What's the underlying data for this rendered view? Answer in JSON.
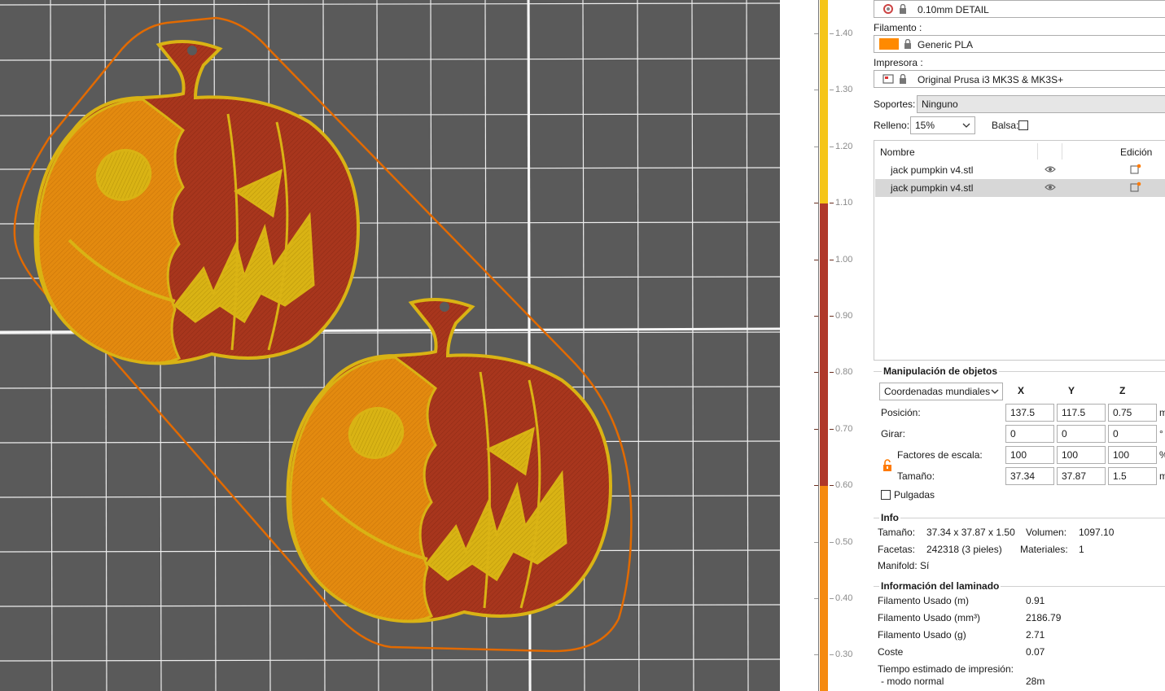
{
  "colors": {
    "bed": "#5a5a5a",
    "grid": "#f2f2f2",
    "skirt": "#e26a00",
    "pumpkin_red": "#a8361d",
    "pumpkin_orange": "#e38a0f",
    "outline_yellow": "#d9b314",
    "accent_orange": "#ff8a00",
    "ruler_yellow": "#f5c518",
    "ruler_red": "#b0382a",
    "ruler_orange": "#f58a10"
  },
  "ruler": {
    "ticks": [
      "1.40",
      "1.30",
      "1.20",
      "1.10",
      "1.00",
      "0.90",
      "0.80",
      "0.70",
      "0.60",
      "0.50",
      "0.40",
      "0.30"
    ]
  },
  "print_settings": {
    "profile": "0.10mm DETAIL",
    "filament_label": "Filamento :",
    "filament": "Generic PLA",
    "printer_label": "Impresora :",
    "printer": "Original Prusa i3 MK3S & MK3S+",
    "supports_label": "Soportes:",
    "supports": "Ninguno",
    "infill_label": "Relleno:",
    "infill": "15%",
    "brim_label": "Balsa:"
  },
  "object_list": {
    "col_name": "Nombre",
    "col_edit": "Edición",
    "items": [
      {
        "name": "jack pumpkin v4.stl"
      },
      {
        "name": "jack pumpkin v4.stl"
      }
    ]
  },
  "manipulation": {
    "title": "Manipulación de objetos",
    "coord_select": "Coordenadas mundiales",
    "axis_x": "X",
    "axis_y": "Y",
    "axis_z": "Z",
    "position_label": "Posición:",
    "position": [
      "137.5",
      "117.5",
      "0.75"
    ],
    "rotate_label": "Girar:",
    "rotate": [
      "0",
      "0",
      "0"
    ],
    "scale_label": "Factores de escala:",
    "scale": [
      "100",
      "100",
      "100"
    ],
    "size_label": "Tamaño:",
    "size": [
      "37.34",
      "37.87",
      "1.5"
    ],
    "unit_mm": "m",
    "unit_deg": "°",
    "unit_pct": "%",
    "inches_label": "Pulgadas"
  },
  "info": {
    "title": "Info",
    "size_label": "Tamaño:",
    "size": "37.34 x 37.87 x 1.50",
    "volume_label": "Volumen:",
    "volume": "1097.10",
    "facets_label": "Facetas:",
    "facets": "242318 (3 pieles)",
    "materials_label": "Materiales:",
    "materials": "1",
    "manifold_label": "Manifold:",
    "manifold": "Sí"
  },
  "slice_info": {
    "title": "Información del laminado",
    "rows": [
      {
        "label": "Filamento Usado (m)",
        "value": "0.91"
      },
      {
        "label": "Filamento Usado (mm³)",
        "value": "2186.79"
      },
      {
        "label": "Filamento Usado (g)",
        "value": "2.71"
      },
      {
        "label": "Coste",
        "value": "0.07"
      }
    ],
    "time_label": "Tiempo estimado de impresión:",
    "normal_mode_label": "- modo normal",
    "normal_mode": "28m"
  }
}
